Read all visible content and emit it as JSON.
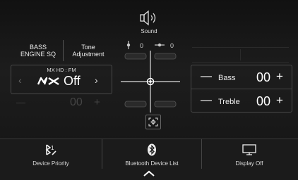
{
  "header": {
    "icon": "speaker-sound-icon",
    "title": "Sound"
  },
  "tabs": [
    {
      "label_line1": "BASS",
      "label_line2": "ENGINE SQ"
    },
    {
      "label_line1": "Tone",
      "label_line2": "Adjustment"
    }
  ],
  "mx": {
    "source_label": "MX HD : FM",
    "logo_text": "MX",
    "value": "Off"
  },
  "dim_row": {
    "minus": "—",
    "value": "00",
    "plus": "+"
  },
  "position": {
    "front_rear_value": "0",
    "left_right_value": "0"
  },
  "tone": {
    "rows": [
      {
        "label": "Bass",
        "value": "00",
        "minus": "—",
        "plus": "+"
      },
      {
        "label": "Treble",
        "value": "00",
        "minus": "—",
        "plus": "+"
      }
    ]
  },
  "bottom_bar": {
    "items": [
      {
        "label": "Device Priority",
        "icon": "device-priority-icon"
      },
      {
        "label": "Bluetooth Device List",
        "icon": "bluetooth-icon"
      },
      {
        "label": "Display Off",
        "icon": "display-off-icon"
      }
    ]
  }
}
